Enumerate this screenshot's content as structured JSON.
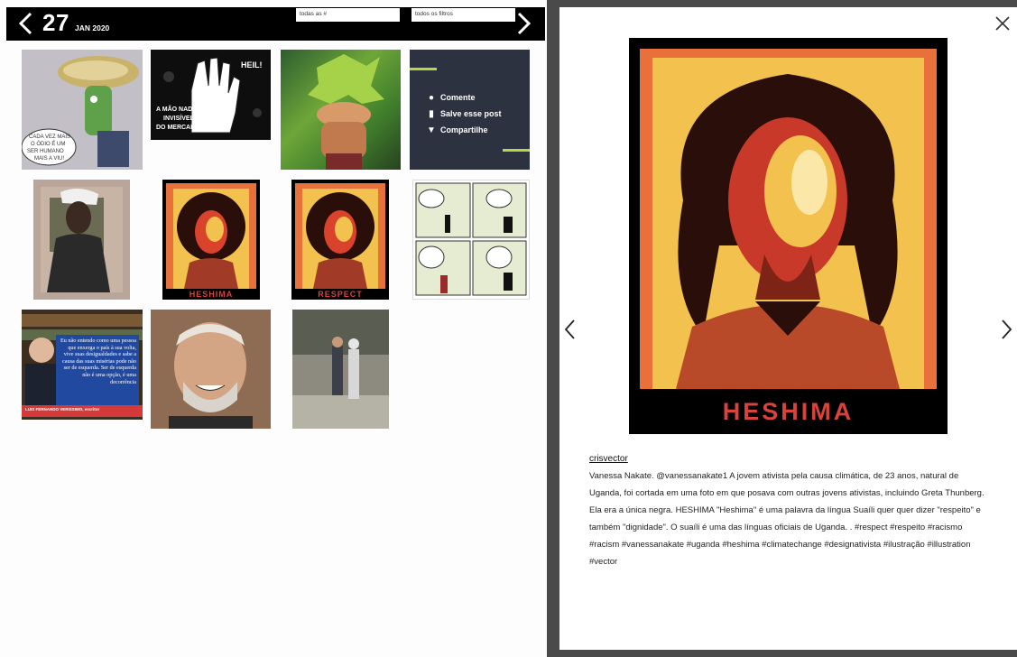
{
  "header": {
    "day": "27",
    "month_year": "JAN 2020",
    "hashtags_filter": "todas as #",
    "all_filters": "todos os filtros"
  },
  "thumbs": {
    "t1_bubble": "CADA VEZ MAIS O ÓDIO É UM SER HUMANO MAIS A VIU!",
    "t2_title": "HEIL!",
    "t2_text": "A MÃO NADA INVISÍVEL DO MERCADO",
    "t6_label": "HESHIMA",
    "t7_label": "RESPECT",
    "t9_quote": "Eu não entendo como uma pessoa que enxerga o país à sua volta, vive suas desigualdades e sabe a causa das suas misérias pode não ser de esquerda. Ser de esquerda não é uma opção, é uma decorrência",
    "t9_author": "LUIS FERNANDO VERISSIMO, escritor"
  },
  "post_actions": {
    "comment": "Comente",
    "save": "Salve esse post",
    "share": "Compartilhe"
  },
  "modal": {
    "image_label": "HESHIMA",
    "author": "crisvector",
    "caption": "Vanessa Nakate. @vanessanakate1 A jovem ativista pela causa climática, de 23 anos, natural de Uganda, foi cortada em uma foto em que posava com outras jovens ativistas, incluindo Greta Thunberg. Ela era a única negra. HESHIMA \"Heshima\" é uma palavra da língua Suaíli quer quer dizer \"respeito\" e também \"dignidade\". O suaíli é uma das línguas oficiais de Uganda. . #respect #respeito #racismo #racism #vanessanakate #uganda #heshima #climatechange #designativista #ilustração #illustration #vector"
  },
  "colors": {
    "topbar": "#000000",
    "poster_red": "#d9433b",
    "poster_orange": "#e8703a",
    "poster_yellow": "#f2c14e",
    "accent_green": "#b8d64a",
    "quote_blue": "#2149a0"
  }
}
